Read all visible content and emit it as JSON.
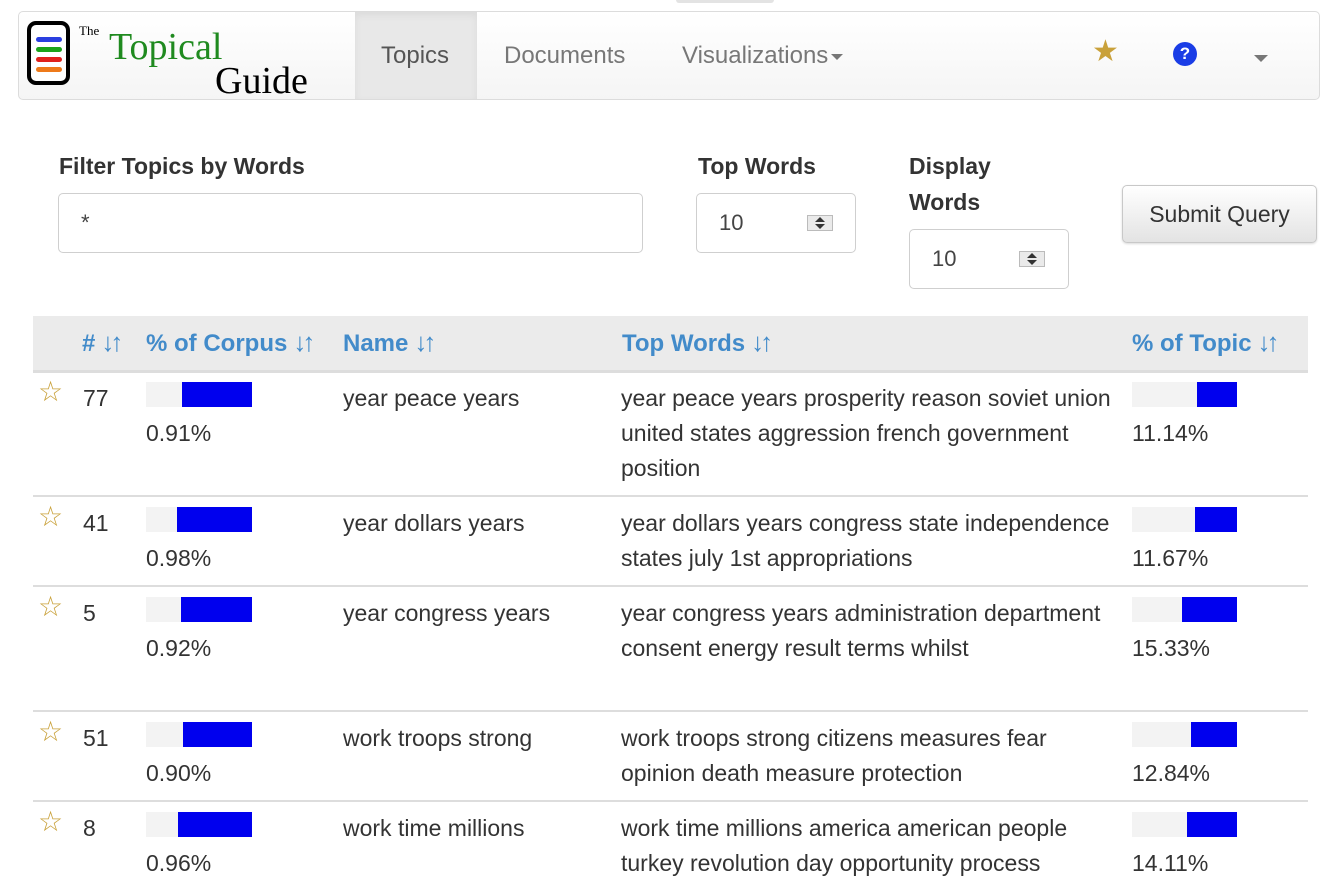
{
  "navbar": {
    "brand_the": "The",
    "brand_topical": "Topical",
    "brand_guide": "Guide",
    "tabs": [
      "Topics",
      "Documents",
      "Visualizations"
    ],
    "star_glyph": "★",
    "help_glyph": "?"
  },
  "form": {
    "filter_label": "Filter Topics by Words",
    "filter_value": "*",
    "top_words_label": "Top Words",
    "top_words_value": "10",
    "display_words_label": "Display Words",
    "display_words_value": "10",
    "submit_label": "Submit Query"
  },
  "table": {
    "headers": [
      "#",
      "% of Corpus",
      "Name",
      "Top Words",
      "% of Topic"
    ],
    "sort_glyph": "↓↑",
    "star_glyph": "☆",
    "rows": [
      {
        "num": "77",
        "corpus": "0.91%",
        "corpus_fill": 0.66,
        "name": "year peace years",
        "words": "year peace years prosperity reason soviet union united states aggression french government position",
        "topic": "11.14%",
        "topic_fill": 0.38
      },
      {
        "num": "41",
        "corpus": "0.98%",
        "corpus_fill": 0.71,
        "name": "year dollars years",
        "words": "year dollars years congress state independence states july 1st appropriations",
        "topic": "11.67%",
        "topic_fill": 0.4
      },
      {
        "num": "5",
        "corpus": "0.92%",
        "corpus_fill": 0.67,
        "name": "year congress years",
        "words": "year congress years administration department consent energy result terms whilst",
        "topic": "15.33%",
        "topic_fill": 0.52
      },
      {
        "num": "51",
        "corpus": "0.90%",
        "corpus_fill": 0.65,
        "name": "work troops strong",
        "words": "work troops strong citizens measures fear opinion death measure protection",
        "topic": "12.84%",
        "topic_fill": 0.44
      },
      {
        "num": "8",
        "corpus": "0.96%",
        "corpus_fill": 0.7,
        "name": "work time millions",
        "words": "work time millions america american people turkey revolution day opportunity process",
        "topic": "14.11%",
        "topic_fill": 0.48
      }
    ]
  },
  "colors": {
    "link": "#428bca",
    "bar_fill": "#0000ee",
    "star": "#c9a13a",
    "help": "#1a3de6"
  }
}
